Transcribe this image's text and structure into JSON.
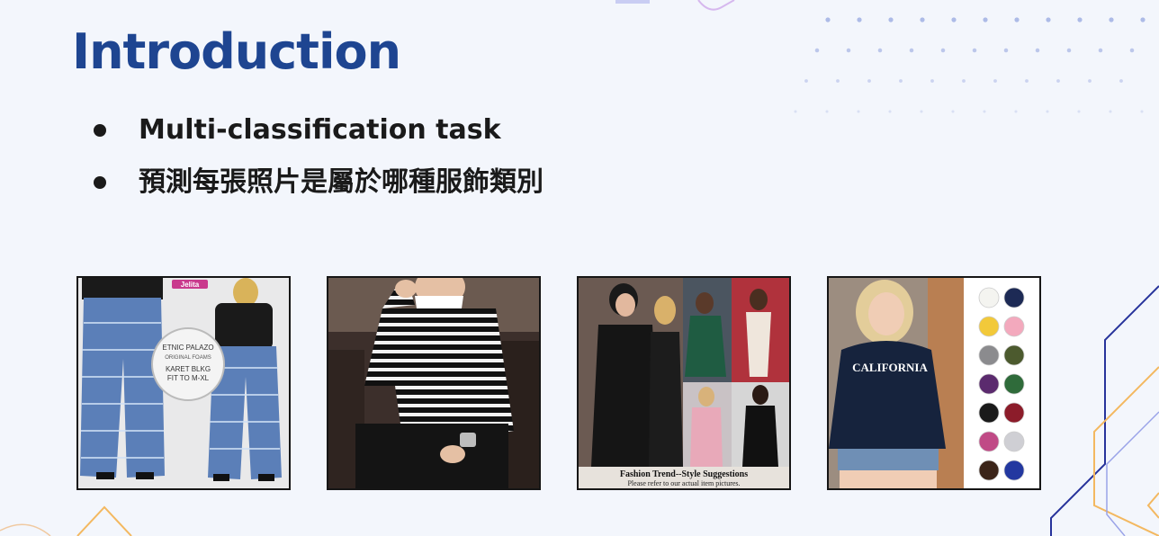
{
  "slide": {
    "title": "Introduction",
    "bullets": [
      "Multi-classification task",
      "預測每張照片是屬於哪種服飾類別"
    ]
  },
  "images": [
    {
      "label": "Jelita",
      "badge_lines": [
        "ETNIC PALAZO",
        "ORIGINAL FOAMS",
        "KARET BLKG",
        "FIT TO M-XL"
      ]
    },
    {},
    {
      "caption_title": "Fashion Trend--Style Suggestions",
      "caption_sub": "Please refer to our actual item pictures."
    },
    {
      "shirt_text": "CALIFORNIA"
    }
  ],
  "colors": {
    "title": "#1e4591",
    "background": "#f3f6fc",
    "accent_orange": "#f3b860",
    "accent_navy": "#27339b"
  }
}
